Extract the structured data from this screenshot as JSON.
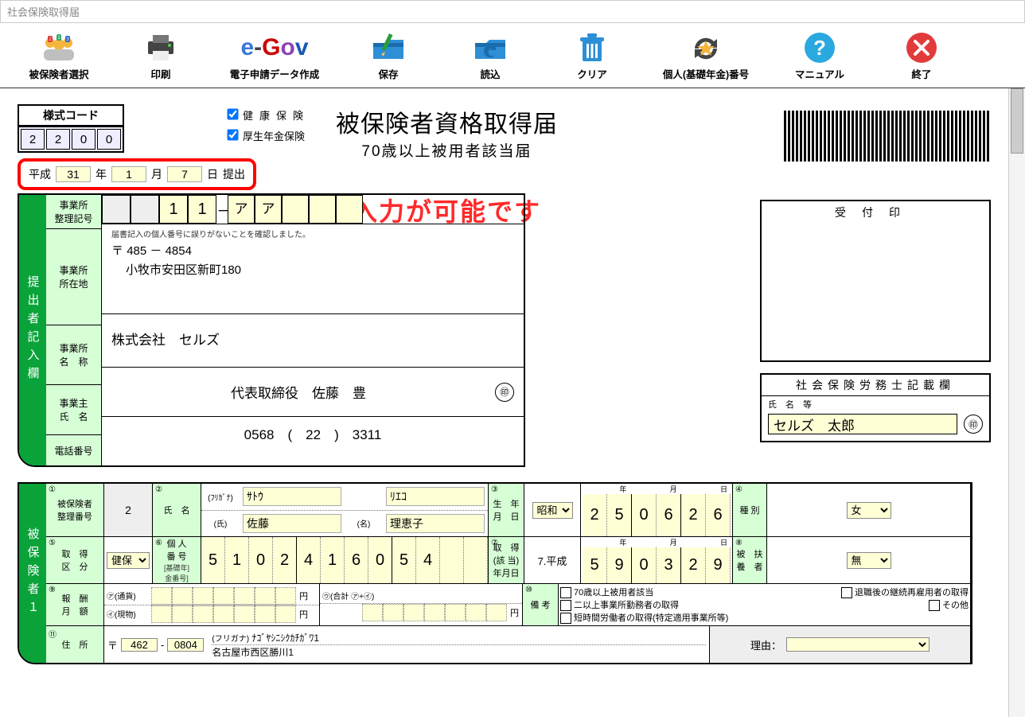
{
  "window": {
    "title": "社会保険取得届"
  },
  "toolbar": {
    "select": "被保険者選択",
    "print": "印刷",
    "egov": "電子申請データ作成",
    "save": "保存",
    "load": "読込",
    "clear": "クリア",
    "pension": "個人(基礎年金)番号",
    "manual": "マニュアル",
    "close": "終了"
  },
  "form_code": {
    "label": "様式コード",
    "digits": [
      "2",
      "2",
      "0",
      "0"
    ]
  },
  "checks": {
    "kenpo": "健康保険",
    "kosei": "厚生年金保険",
    "kenpo_checked": true,
    "kosei_checked": true
  },
  "titles": {
    "main": "被保険者資格取得届",
    "sub": "70歳以上被用者該当届"
  },
  "date": {
    "era": "平成",
    "y": "31",
    "m": "1",
    "d": "7",
    "y_u": "年",
    "m_u": "月",
    "d_u": "日",
    "submit": "提出"
  },
  "callout": "直接入力が可能です",
  "submitter": {
    "tab": "提出者記入欄",
    "labels": {
      "regno": "事業所\n整理記号",
      "addr": "事業所\n所在地",
      "name": "事業所\n名　称",
      "owner": "事業主\n氏　名",
      "tel": "電話番号"
    },
    "regno_digits": [
      "",
      "",
      "1",
      "1"
    ],
    "regno_dash": "－",
    "regno_kana": [
      "ア",
      "ア",
      "",
      "",
      ""
    ],
    "note": "届書記入の個人番号に誤りがないことを確認しました。",
    "zip_mark": "〒",
    "zip1": "485",
    "zip2": "4854",
    "address": "小牧市安田区新町180",
    "office_name": "株式会社　セルズ",
    "owner_name": "代表取締役　佐藤　豊",
    "seal": "㊞",
    "tel_a": "0568",
    "tel_b": "22",
    "tel_c": "3311"
  },
  "receipt": {
    "label": "受付印"
  },
  "sr": {
    "header": "社会保険労務士記載欄",
    "label": "氏　名　等",
    "value": "セルズ　太郎",
    "seal": "㊞"
  },
  "insured": {
    "tab": "被保険者１",
    "h": {
      "no": "①",
      "no_l1": "被保険者",
      "no_l2": "整理番号",
      "name": "②",
      "name_l": "氏　名",
      "furi": "(ﾌﾘｶﾞﾅ)",
      "shi": "(氏)",
      "mei": "(名)",
      "dob": "③",
      "dob_l1": "生　年",
      "dob_l2": "月　日",
      "type": "④",
      "type_l": "種 別",
      "div": "⑤",
      "div_l1": "取　得",
      "div_l2": "区　分",
      "mynum": "⑥",
      "mynum_l1": "個 人",
      "mynum_l2": "番 号",
      "mynum_l3": "[基礎年]",
      "mynum_l4": "金番号]",
      "acq": "⑦",
      "acq_l1": "取　得",
      "acq_l2": "(該 当)",
      "acq_l3": "年月日",
      "dep": "⑧",
      "dep_l1": "被　扶",
      "dep_l2": "養　者",
      "sal": "⑨",
      "sal_l1": "報　酬",
      "sal_l2": "月　額",
      "sal_a": "㋐(通貨)",
      "sal_b": "㋑(現物)",
      "sal_c": "㋒(合計 ㋐+㋑)",
      "yen": "円",
      "rem": "⑩",
      "rem_l": "備 考",
      "addr": "⑪",
      "addr_l": "住　所",
      "reason": "理由："
    },
    "remarks": {
      "r1": "70歳以上被用者該当",
      "r2": "二以上事業所勤務者の取得",
      "r3": "短時間労働者の取得(特定適用事業所等)",
      "r4": "退職後の継続再雇用者の取得",
      "r5": "その他"
    },
    "yr_units": {
      "y": "年",
      "m": "月",
      "d": "日"
    },
    "data": {
      "seq": "2",
      "kana_sei": "ｻﾄｳ",
      "kana_mei": "ﾘｴｺ",
      "kanji_sei": "佐藤",
      "kanji_mei": "理恵子",
      "dob_era": "昭和",
      "dob_digits": [
        "2",
        "5",
        "0",
        "6",
        "2",
        "6"
      ],
      "type": "女",
      "division": "健保・厚年",
      "mynum": [
        "5",
        "1",
        "0",
        "2",
        "4",
        "1",
        "6",
        "0",
        "5",
        "4",
        "",
        ""
      ],
      "acq_era": "7.平成",
      "acq_digits": [
        "5",
        "9",
        "0",
        "3",
        "2",
        "9"
      ],
      "dependent": "無",
      "addr_zip1": "462",
      "addr_zip2": "0804",
      "addr_kana_l": "(フリガナ)",
      "addr_kana": "ﾅｺﾞﾔｼﾆｼｸｶﾁｶﾞﾜ1",
      "addr_text": "名古屋市西区勝川1"
    }
  }
}
